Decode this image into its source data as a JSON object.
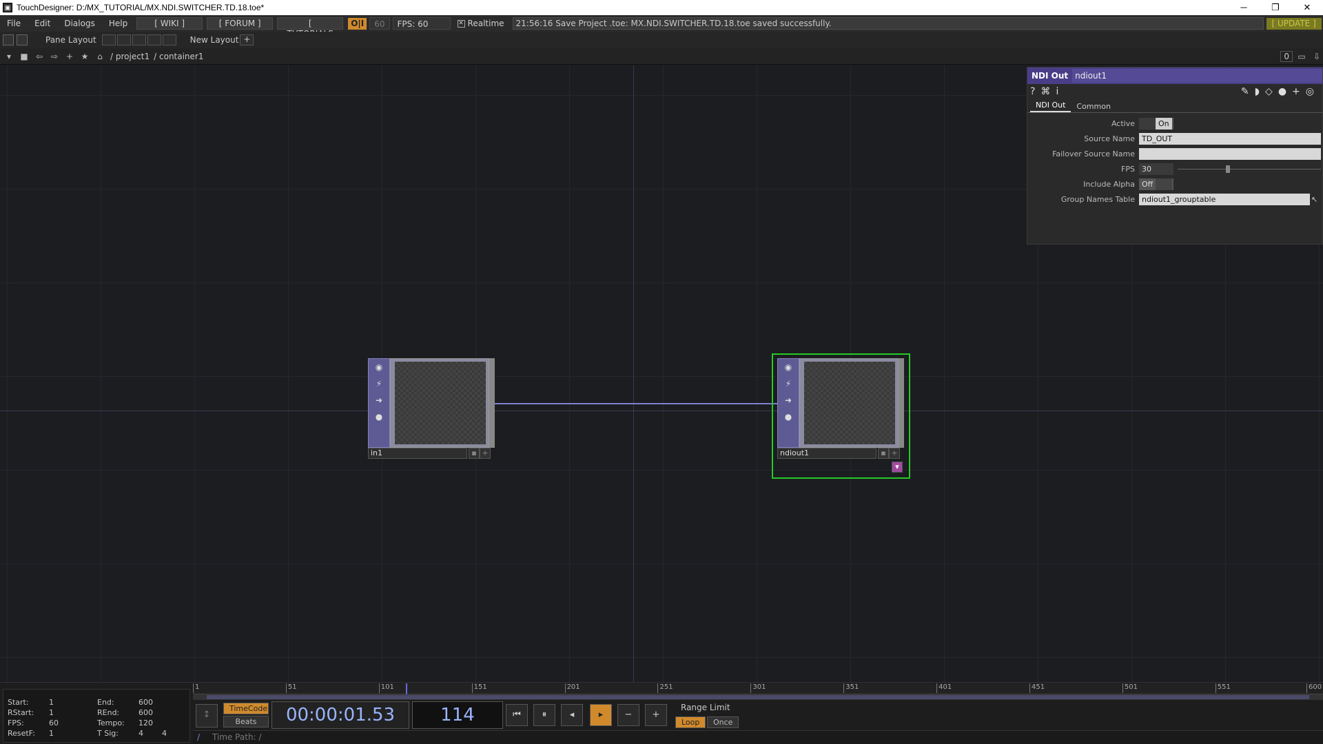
{
  "window": {
    "title": "TouchDesigner: D:/MX_TUTORIAL/MX.NDI.SWITCHER.TD.18.toe*",
    "minimize": "─",
    "maximize": "❐",
    "close": "✕"
  },
  "menu": {
    "items": [
      "File",
      "Edit",
      "Dialogs",
      "Help"
    ],
    "wiki": "[ WIKI ]",
    "forum": "[ FORUM ]",
    "tutorials": "[ TUTORIALS ]",
    "oii": "O|I",
    "sixty": "60",
    "fps": "FPS:  60",
    "realtime": "Realtime",
    "status": "21:56:16 Save Project .toe: MX.NDI.SWITCHER.TD.18.toe saved successfully.",
    "update": "[ UPDATE ]"
  },
  "toolbar": {
    "pane_layout": "Pane Layout",
    "new_layout": "New Layout",
    "plus": "+"
  },
  "pathbar": {
    "path1": "/ project1",
    "path2": "/ container1",
    "zero": "0"
  },
  "nodes": {
    "in1": {
      "label": "in1"
    },
    "ndiout1": {
      "label": "ndiout1"
    }
  },
  "params": {
    "op_type": "NDI Out",
    "op_name": "ndiout1",
    "tabs": [
      "NDI Out",
      "Common"
    ],
    "rows": {
      "active": {
        "label": "Active",
        "value": "On"
      },
      "source_name": {
        "label": "Source Name",
        "value": "TD_OUT"
      },
      "failover": {
        "label": "Failover Source Name",
        "value": ""
      },
      "fps": {
        "label": "FPS",
        "value": "30",
        "slider_fraction": 0.35
      },
      "include_alpha": {
        "label": "Include Alpha",
        "value": "Off"
      },
      "group_names": {
        "label": "Group Names Table",
        "value": "ndiout1_grouptable"
      }
    }
  },
  "timeline": {
    "info": {
      "start_l": "Start:",
      "start_v": "1",
      "end_l": "End:",
      "end_v": "600",
      "rstart_l": "RStart:",
      "rstart_v": "1",
      "rend_l": "REnd:",
      "rend_v": "600",
      "fps_l": "FPS:",
      "fps_v": "60",
      "tempo_l": "Tempo:",
      "tempo_v": "120",
      "resetf_l": "ResetF:",
      "resetf_v": "1",
      "tsig_l": "T Sig:",
      "tsig_v1": "4",
      "tsig_v2": "4"
    },
    "ruler": [
      "1",
      "51",
      "101",
      "151",
      "201",
      "251",
      "301",
      "351",
      "401",
      "451",
      "501",
      "551",
      "600"
    ],
    "timecode_btn": "TimeCode",
    "beats_btn": "Beats",
    "timecode": "00:00:01.53",
    "frame": "114",
    "range_limit": "Range Limit",
    "loop": "Loop",
    "once": "Once",
    "time_path": "Time Path: /",
    "slash": "/",
    "colors": {
      "accent": "#d08a2c",
      "timecode": "#9ab4ff"
    }
  }
}
